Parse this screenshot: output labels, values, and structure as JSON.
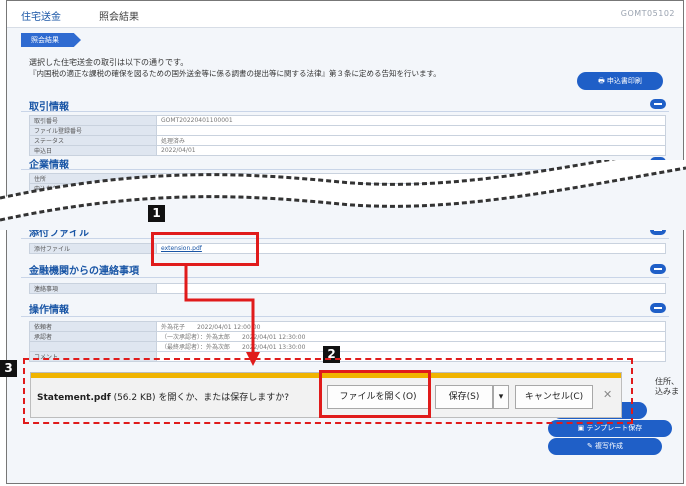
{
  "header": {
    "app_name": "住宅送金",
    "page_name": "照会結果",
    "screen_id": "GOMT05102"
  },
  "step_label": "照会結果",
  "message": {
    "line1": "選択した住宅送金の取引は以下の通りです。",
    "line2": "『内国税の適正な課税の確保を図るための国外送金等に係る調書の提出等に関する法律』第３条に定める告知を行います。"
  },
  "print_button": "申込書印刷",
  "sections": {
    "transaction": {
      "title": "取引情報",
      "rows": [
        {
          "label": "取引番号",
          "value": "GOMT20220401100001"
        },
        {
          "label": "ファイル登録番号",
          "value": ""
        },
        {
          "label": "ステータス",
          "value": "処理済み"
        },
        {
          "label": "申込日",
          "value": "2022/04/01"
        }
      ]
    },
    "applicant": {
      "title": "企業情報",
      "rows": [
        {
          "label": "住所",
          "value": "オオサカ チョウジブ"
        },
        {
          "label": "申込者名",
          "value": ""
        }
      ]
    },
    "attachment": {
      "title": "添付ファイル",
      "row_label": "添付ファイル",
      "file_link": "extension.pdf"
    },
    "bank_contact": {
      "title": "金融機関からの連絡事項",
      "row_label": "連絡事項",
      "row_value": ""
    },
    "operation": {
      "title": "操作情報",
      "rows": [
        {
          "label": "依頼者",
          "value": "外為花子　　2022/04/01 12:00:00"
        },
        {
          "label": "承認者",
          "value": "（一次承認者）：外為太郎　　2022/04/01 12:30:00"
        },
        {
          "label": "",
          "value": "（最終承認者）：外為次郎　　2022/04/01 13:30:00"
        },
        {
          "label": "コメント",
          "value": ""
        }
      ]
    }
  },
  "download_bar": {
    "filename": "Statement.pdf",
    "size": "(56.2 KB)",
    "prompt": "を開くか、または保存しますか?",
    "open_button": "ファイルを開く(O)",
    "save_button": "保存(S)",
    "cancel_button": "キャンセル(C)"
  },
  "side_text": {
    "line1": "住所、",
    "line2": "込みま"
  },
  "template_button": "テンプレート保存",
  "copy_button": "複写作成",
  "callouts": [
    "1",
    "2",
    "3"
  ],
  "colors": {
    "accent": "#1f5fc7",
    "callout": "#e01b1b",
    "download_bar_strip": "#f0b400"
  }
}
